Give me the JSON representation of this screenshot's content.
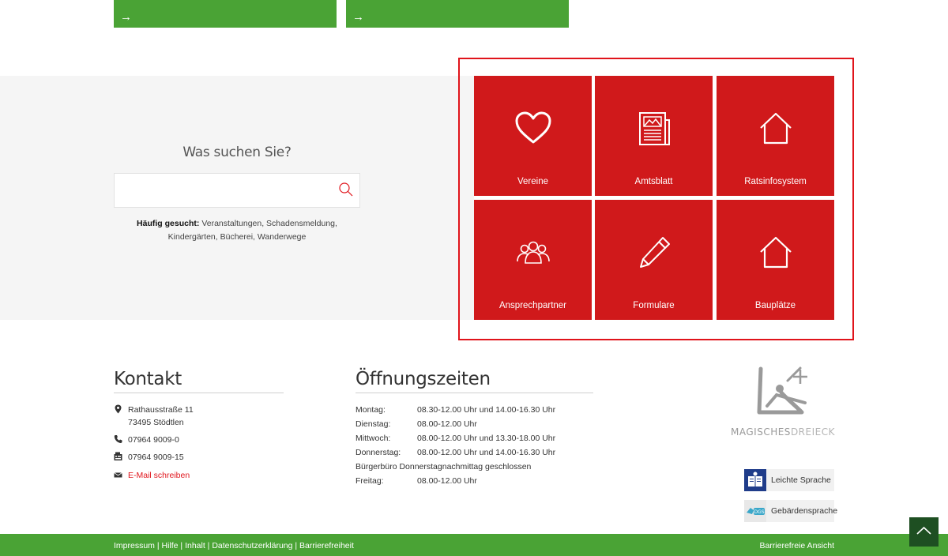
{
  "top_cards": {
    "arrow": "→"
  },
  "search": {
    "title": "Was suchen Sie?",
    "placeholder": "",
    "frequent_label": "Häufig gesucht:",
    "frequent_line1": "Veranstaltungen, Schadensmeldung,",
    "frequent_line2": "Kindergärten, Bücherei, Wanderwege"
  },
  "tiles": [
    {
      "label": "Vereine",
      "icon": "heart-icon"
    },
    {
      "label": "Amtsblatt",
      "icon": "newspaper-icon"
    },
    {
      "label": "Ratsinfosystem",
      "icon": "house-icon"
    },
    {
      "label": "Ansprechpartner",
      "icon": "people-icon"
    },
    {
      "label": "Formulare",
      "icon": "pencil-icon"
    },
    {
      "label": "Bauplätze",
      "icon": "house-icon"
    }
  ],
  "contact": {
    "title": "Kontakt",
    "street": "Rathausstraße 11",
    "city": "73495 Stödtlen",
    "phone": "07964 9009-0",
    "fax": "07964 9009-15",
    "email": "E-Mail schreiben"
  },
  "hours": {
    "title": "Öffnungszeiten",
    "rows": [
      {
        "day": "Montag:",
        "time": "08.30-12.00 Uhr und 14.00-16.30 Uhr"
      },
      {
        "day": "Dienstag:",
        "time": "08.00-12.00 Uhr"
      },
      {
        "day": "Mittwoch:",
        "time": "08.00-12.00 Uhr und 13.30-18.00 Uhr"
      },
      {
        "day": "Donnerstag:",
        "time": "08.00-12.00 Uhr und 14.00-16.30 Uhr"
      },
      {
        "day": "Bürgerbüro Donnerstagnachmittag geschlossen",
        "time": ""
      },
      {
        "day": "Freitag:",
        "time": "08.00-12.00 Uhr"
      }
    ]
  },
  "logo": {
    "part1": "MAGISCHES",
    "part2": "DREIECK"
  },
  "accessibility": {
    "easy_language": "Leichte Sprache",
    "sign_language": "Gebärdensprache"
  },
  "footer": {
    "links": [
      "Impressum",
      "Hilfe",
      "Inhalt",
      "Datenschutzerklärung",
      "Barrierefreiheit"
    ],
    "separator": " | ",
    "right_link": "Barrierefreie Ansicht"
  },
  "colors": {
    "brand_red": "#d0191b",
    "brand_green": "#4aa335",
    "dark_green": "#1e4f22"
  }
}
